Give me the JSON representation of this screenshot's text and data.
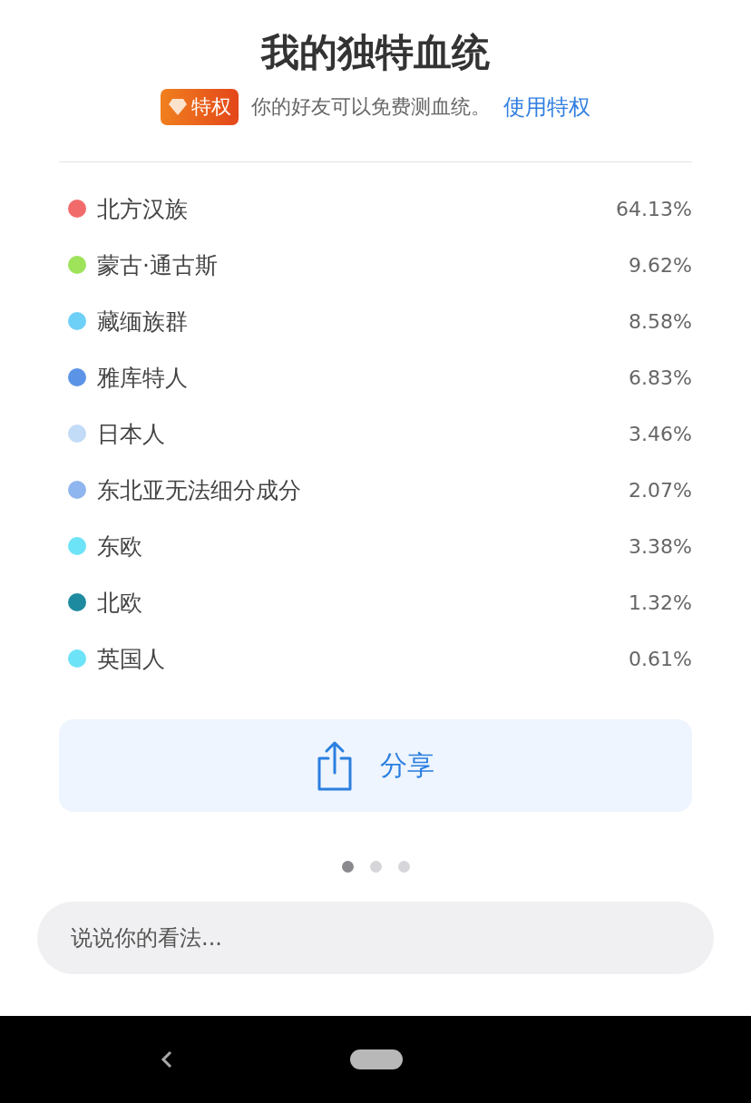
{
  "header": {
    "title": "我的独特血统",
    "badge": "特权",
    "note": "你的好友可以免费测血统。",
    "link": "使用特权"
  },
  "ancestry": [
    {
      "name": "北方汉族",
      "percent": "64.13%",
      "color": "#f26b6b"
    },
    {
      "name": "蒙古·通古斯",
      "percent": "9.62%",
      "color": "#9ee35a"
    },
    {
      "name": "藏缅族群",
      "percent": "8.58%",
      "color": "#6fd0f7"
    },
    {
      "name": "雅库特人",
      "percent": "6.83%",
      "color": "#5b93e6"
    },
    {
      "name": "日本人",
      "percent": "3.46%",
      "color": "#c2dbf7"
    },
    {
      "name": "东北亚无法细分成分",
      "percent": "2.07%",
      "color": "#8fb6ee"
    },
    {
      "name": "东欧",
      "percent": "3.38%",
      "color": "#6de3f7"
    },
    {
      "name": "北欧",
      "percent": "1.32%",
      "color": "#1d8aa0"
    },
    {
      "name": "英国人",
      "percent": "0.61%",
      "color": "#6de3f7"
    }
  ],
  "share_button": {
    "label": "分享"
  },
  "pager": [
    {
      "selected": true
    },
    {
      "selected": false
    },
    {
      "selected": false
    }
  ],
  "comment": {
    "placeholder": "说说你的看法..."
  }
}
